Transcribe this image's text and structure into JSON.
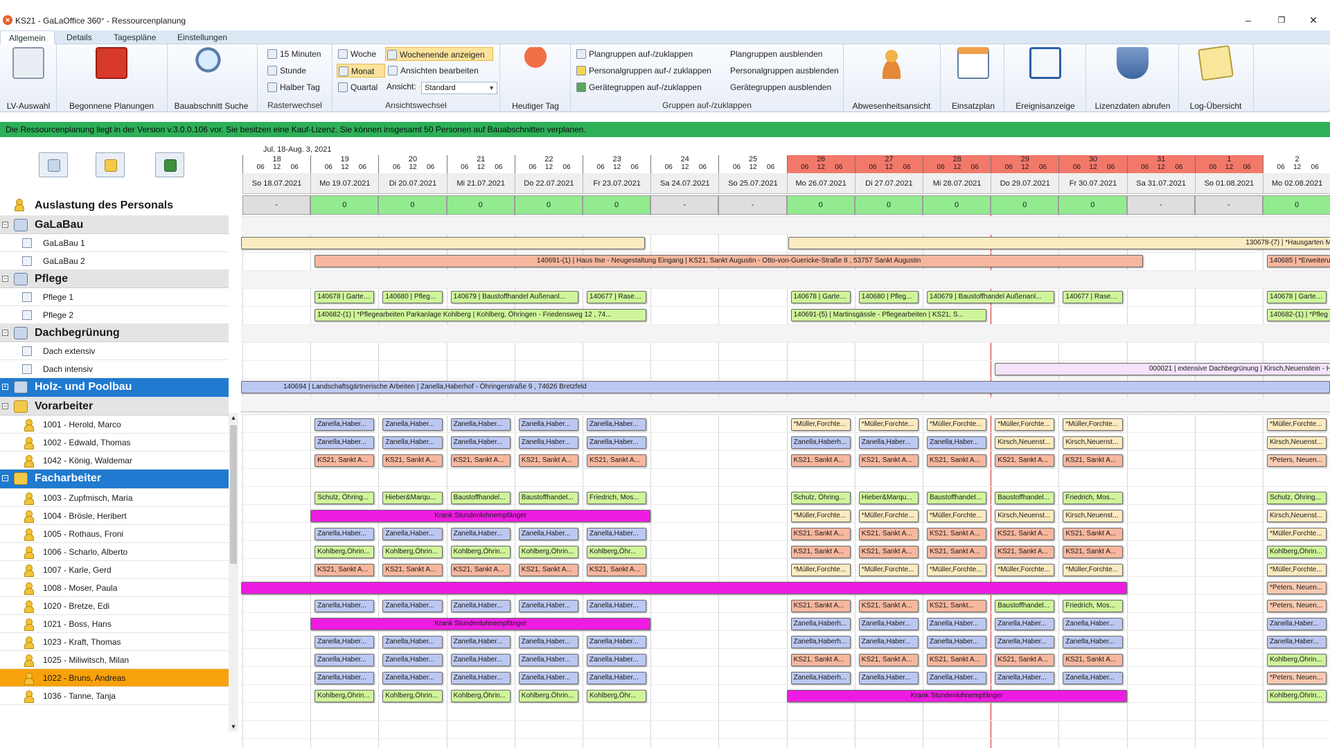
{
  "window": {
    "app_icon": "app-icon",
    "title": "KS21 - GaLaOffice 360° - Ressourcenplanung",
    "minimize": "–",
    "maximize": "❐",
    "close": "✕"
  },
  "menu_tabs": [
    "Allgemein",
    "Details",
    "Tagespläne",
    "Einstellungen"
  ],
  "ribbon": {
    "lv_auswahl": "LV-Auswahl",
    "begonnene": "Begonnene Planungen",
    "bauabschnitt": "Bauabschnitt Suche",
    "raster": {
      "label": "Rasterwechsel",
      "items": [
        "15 Minuten",
        "Stunde",
        "Halber Tag"
      ]
    },
    "ansicht": {
      "label": "Ansichtswechsel",
      "woche": "Woche",
      "monat": "Monat",
      "quartal": "Quartal",
      "wochenende": "Wochenende anzeigen",
      "ansichten": "Ansichten bearbeiten",
      "ansicht_label": "Ansicht:",
      "ansicht_value": "Standard"
    },
    "heutiger_tag": "Heutiger Tag",
    "gruppen": {
      "label": "Gruppen auf-/zuklappen",
      "items": [
        "Plangruppen auf-/zuklappen",
        "Personalgruppen auf-/ zuklappen",
        "Gerätegruppen auf-/zuklappen",
        "Plangruppen ausblenden",
        "Personalgruppen ausblenden",
        "Gerätegruppen ausblenden"
      ]
    },
    "abwesenheit": "Abwesenheitsansicht",
    "einsatzplan": "Einsatzplan",
    "ereignis": "Ereignisanzeige",
    "lizenz": "Lizenzdaten abrufen",
    "log": "Log-Übersicht"
  },
  "info_bar": "Die Ressourcenplanung liegt in der Version v.3.0.0.106 vor. Sie besitzen eine Kauf-Lizenz. Sie können insgesamt 50 Personen auf Bauabschnitten verplanen.",
  "colors": {
    "accent": "#1f7ad0",
    "info_green": "#2db058",
    "weekend_head": "#f2786a",
    "load_ok": "#92ec8f",
    "selected": "#f7a10b",
    "sick_magenta": "#ee1ce2"
  },
  "resources": {
    "auslastung": "Auslastung des Personals",
    "galabau": "GaLaBau",
    "galabau_1": "GaLaBau 1",
    "galabau_2": "GaLaBau 2",
    "pflege": "Pflege",
    "pflege_1": "Pflege 1",
    "pflege_2": "Pflege 2",
    "dach": "Dachbegrünung",
    "dach_ext": "Dach extensiv",
    "dach_int": "Dach intensiv",
    "holz": "Holz- und Poolbau",
    "vorarbeiter": "Vorarbeiter",
    "vorarbeiter_people": [
      "1001 - Herold, Marco",
      "1002 - Edwald, Thomas",
      "1042 - König, Waldemar"
    ],
    "facharbeiter": "Facharbeiter",
    "facharbeiter_people": [
      "1003 - Zupfmisch, Maria",
      "1004 - Brösle, Heribert",
      "1005 - Rothaus, Froni",
      "1006 - Scharlo, Alberto",
      "1007 - Karle, Gerd",
      "1008 - Moser, Paula",
      "1020 - Bretze, Edi",
      "1021 - Boss, Hans",
      "1023 - Kraft, Thomas",
      "1025 - Miliwitsch, Milan",
      "1022 - Bruns, Andreas",
      "1036 - Tanne, Tanja"
    ]
  },
  "timeline": {
    "range_label": "Jul. 18-Aug. 3, 2021",
    "day_numbers": [
      "18",
      "19",
      "20",
      "21",
      "22",
      "23",
      "24",
      "25",
      "26",
      "27",
      "28",
      "29",
      "30",
      "31",
      "1",
      "2"
    ],
    "tick_labels": [
      "12",
      "06"
    ],
    "dates": [
      "So 18.07.2021",
      "Mo 19.07.2021",
      "Di 20.07.2021",
      "Mi 21.07.2021",
      "Do 22.07.2021",
      "Fr 23.07.2021",
      "Sa 24.07.2021",
      "So 25.07.2021",
      "Mo 26.07.2021",
      "Di 27.07.2021",
      "Mi 28.07.2021",
      "Do 29.07.2021",
      "Fr 30.07.2021",
      "Sa 31.07.2021",
      "So 01.08.2021",
      "Mo 02.08.2021"
    ],
    "weekend_head": [
      false,
      false,
      false,
      false,
      false,
      false,
      false,
      false,
      true,
      true,
      true,
      true,
      true,
      true,
      true,
      false
    ],
    "load": [
      "-",
      "0",
      "0",
      "0",
      "0",
      "0",
      "-",
      "-",
      "0",
      "0",
      "0",
      "0",
      "0",
      "-",
      "-",
      "0"
    ]
  },
  "bars": {
    "galabau1_a": "",
    "galabau1_b": "130678-(7) | *Hausgarten M",
    "galabau2_a": "140691-(1) | Haus Ilse - Neugestaltung Eingang | KS21, Sankt Augustin - Otto-von-Guericke-Straße 8 , 53757 Sankt Augustin",
    "galabau2_b": "140685 | *Erweiterun",
    "pflege1": [
      "140678 | Garten...",
      "140680 | Pfleg...",
      "140679 | Baustoffhandel Außenanl...",
      "140677 | Rasen...",
      "140678 | Garten...",
      "140680 | Pfleg...",
      "140679 | Baustoffhandel Außenanl...",
      "140677 | Rasen...",
      "140678 | Garten..."
    ],
    "pflege2": [
      "140682-(1) | *Pflegearbeiten Parkanlage Kohlberg | Kohlberg, Öhringen - Friedensweg 12 , 74...",
      "140691-(5) | Martinsgässle - Pflegearbeiten | KS21, S...",
      "140682-(1) | *Pfleg"
    ],
    "dach_int": "000021 | extensive Dachbegrünung | Kirsch,Neuenstein - H",
    "holz": "140694 | Landschaftsgärtnerische Arbeiten | Zanella,Haberhof - Öhringerstraße 9 , 74626 Bretzfeld",
    "herold": [
      "Zanella,Haber...",
      "Zanella,Haber...",
      "Zanella,Haber...",
      "Zanella,Haber...",
      "Zanella,Haber...",
      "*Müller,Forchte...",
      "*Müller,Forchte...",
      "*Müller,Forchte...",
      "*Müller,Forchte...",
      "*Müller,Forchte...",
      "*Müller,Forchte..."
    ],
    "edwald": [
      "Zanella,Haber...",
      "Zanella,Haber...",
      "Zanella,Haber...",
      "Zanella,Haber...",
      "Zanella,Haber...",
      "Zanella,Haberh...",
      "Zanella,Haber...",
      "Zanella,Haber...",
      "Kirsch,Neuenst...",
      "Kirsch,Neuenst...",
      "Kirsch,Neuenst..."
    ],
    "koenig": [
      "KS21, Sankt A...",
      "KS21, Sankt A...",
      "KS21, Sankt A...",
      "KS21, Sankt A...",
      "KS21, Sankt A...",
      "KS21, Sankt A...",
      "KS21, Sankt A...",
      "KS21, Sankt A...",
      "KS21, Sankt A...",
      "KS21, Sankt A...",
      "*Peters, Neuen..."
    ],
    "zupfmisch": [
      "Schulz, Öhring...",
      "Hieber&Marqu...",
      "Baustoffhandel...",
      "Baustoffhandel...",
      "Friedrich, Mos...",
      "Schulz, Öhring...",
      "Hieber&Marqu...",
      "Baustoffhandel...",
      "Baustoffhandel...",
      "Friedrich, Mos...",
      "Schulz, Öhring..."
    ],
    "broesle": [
      "Krank Stundenlohnempfänger",
      "*Müller,Forchte...",
      "*Müller,Forchte...",
      "*Müller,Forchte...",
      "Kirsch,Neuenst...",
      "Kirsch,Neuenst...",
      "Kirsch,Neuenst..."
    ],
    "rothaus": [
      "Zanella,Haber...",
      "Zanella,Haber...",
      "Zanella,Haber...",
      "Zanella,Haber...",
      "Zanella,Haber...",
      "KS21, Sankt A...",
      "KS21, Sankt A...",
      "KS21, Sankt A...",
      "KS21, Sankt A...",
      "KS21, Sankt A...",
      "*Müller,Forchte..."
    ],
    "scharlo": [
      "Kohlberg,Öhrin...",
      "Kohlberg,Öhrin...",
      "Kohlberg,Öhrin...",
      "Kohlberg,Öhrin...",
      "Kohlberg,Öhr...",
      "KS21, Sankt A...",
      "KS21, Sankt A...",
      "KS21, Sankt A...",
      "KS21, Sankt A...",
      "KS21, Sankt A...",
      "Kohlberg,Öhrin..."
    ],
    "karle": [
      "KS21, Sankt A...",
      "KS21, Sankt A...",
      "KS21, Sankt A...",
      "KS21, Sankt A...",
      "KS21, Sankt A...",
      "*Müller,Forchte...",
      "*Müller,Forchte...",
      "*Müller,Forchte...",
      "*Müller,Forchte...",
      "*Müller,Forchte...",
      "*Müller,Forchte..."
    ],
    "moser": [
      "",
      "*Peters, Neuen..."
    ],
    "bretze": [
      "Zanella,Haber...",
      "Zanella,Haber...",
      "Zanella,Haber...",
      "Zanella,Haber...",
      "Zanella,Haber...",
      "KS21, Sankt A...",
      "KS21, Sankt A...",
      "KS21, Sankt...",
      "Baustoffhandel...",
      "Friedrich, Mos...",
      "*Peters, Neuen..."
    ],
    "boss": [
      "Krank Stundenlohnempfänger",
      "Zanella,Haberh...",
      "Zanella,Haber...",
      "Zanella,Haber...",
      "Zanella,Haber...",
      "Zanella,Haber...",
      "Zanella,Haber..."
    ],
    "kraft": [
      "Zanella,Haber...",
      "Zanella,Haber...",
      "Zanella,Haber...",
      "Zanella,Haber...",
      "Zanella,Haber...",
      "Zanella,Haberh...",
      "Zanella,Haber...",
      "Zanella,Haber...",
      "Zanella,Haber...",
      "Zanella,Haber...",
      "Zanella,Haber..."
    ],
    "miliwitsch": [
      "Zanella,Haber...",
      "Zanella,Haber...",
      "Zanella,Haber...",
      "Zanella,Haber...",
      "Zanella,Haber...",
      "KS21, Sankt A...",
      "KS21, Sankt A...",
      "KS21, Sankt A...",
      "KS21, Sankt A...",
      "KS21, Sankt A...",
      "Kohlberg,Öhrin..."
    ],
    "bruns": [
      "Zanella,Haber...",
      "Zanella,Haber...",
      "Zanella,Haber...",
      "Zanella,Haber...",
      "Zanella,Haber...",
      "Zanella,Haberh...",
      "Zanella,Haber...",
      "Zanella,Haber...",
      "Zanella,Haber...",
      "Zanella,Haber...",
      "*Peters, Neuen..."
    ],
    "tanne": [
      "Kohlberg,Öhrin...",
      "Kohlberg,Öhrin...",
      "Kohlberg,Öhrin...",
      "Kohlberg,Öhrin...",
      "Kohlberg,Öhr...",
      "Krank Stundenlohnempfänger",
      "Kohlberg,Öhrin..."
    ]
  }
}
